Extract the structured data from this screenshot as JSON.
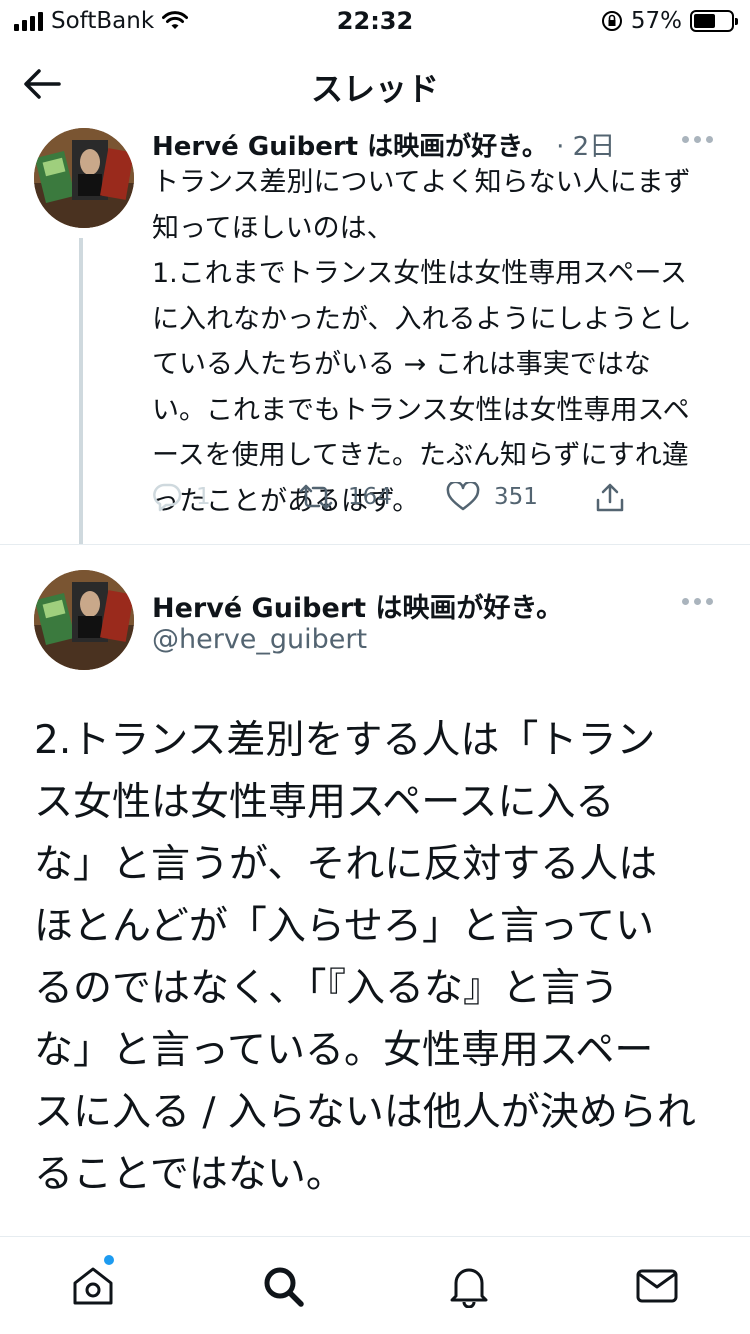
{
  "status_bar": {
    "carrier": "SoftBank",
    "time": "22:32",
    "battery": "57%",
    "battery_level": 0.57
  },
  "header": {
    "title": "スレッド",
    "back_icon": "arrow-left-icon"
  },
  "thread_parent": {
    "display_name": "Hervé Guibert は映画が好き。",
    "meta": "· 2日",
    "text": "トランス差別についてよく知らない人にまず\n知ってほしいのは、\n1.これまでトランス女性は女性専用スペース\nに入れなかったが、入れるようにしようとし\nている人たちがいる → これは事実ではな\nい。これまでもトランス女性は女性専用スペ\nースを使用してきた。たぶん知らずにすれ違\nったことがあるはず。",
    "replies": "1",
    "retweets": "164",
    "likes": "351"
  },
  "main_tweet": {
    "display_name": "Hervé Guibert は映画が好き。",
    "handle": "@herve_guibert",
    "text": "2.トランス差別をする人は「トラン\nス女性は女性専用スペースに入る\nな」と言うが、それに反対する人は\nほとんどが「入らせろ」と言ってい\nるのではなく、「『入るな』と言う\nな」と言っている。女性専用スペー\nスに入る / 入らないは他人が決められ\nることではない。"
  },
  "bottom_nav": {
    "items": [
      "home-icon",
      "search-icon",
      "bell-icon",
      "mail-icon"
    ],
    "accent": "#1d9bf0"
  }
}
